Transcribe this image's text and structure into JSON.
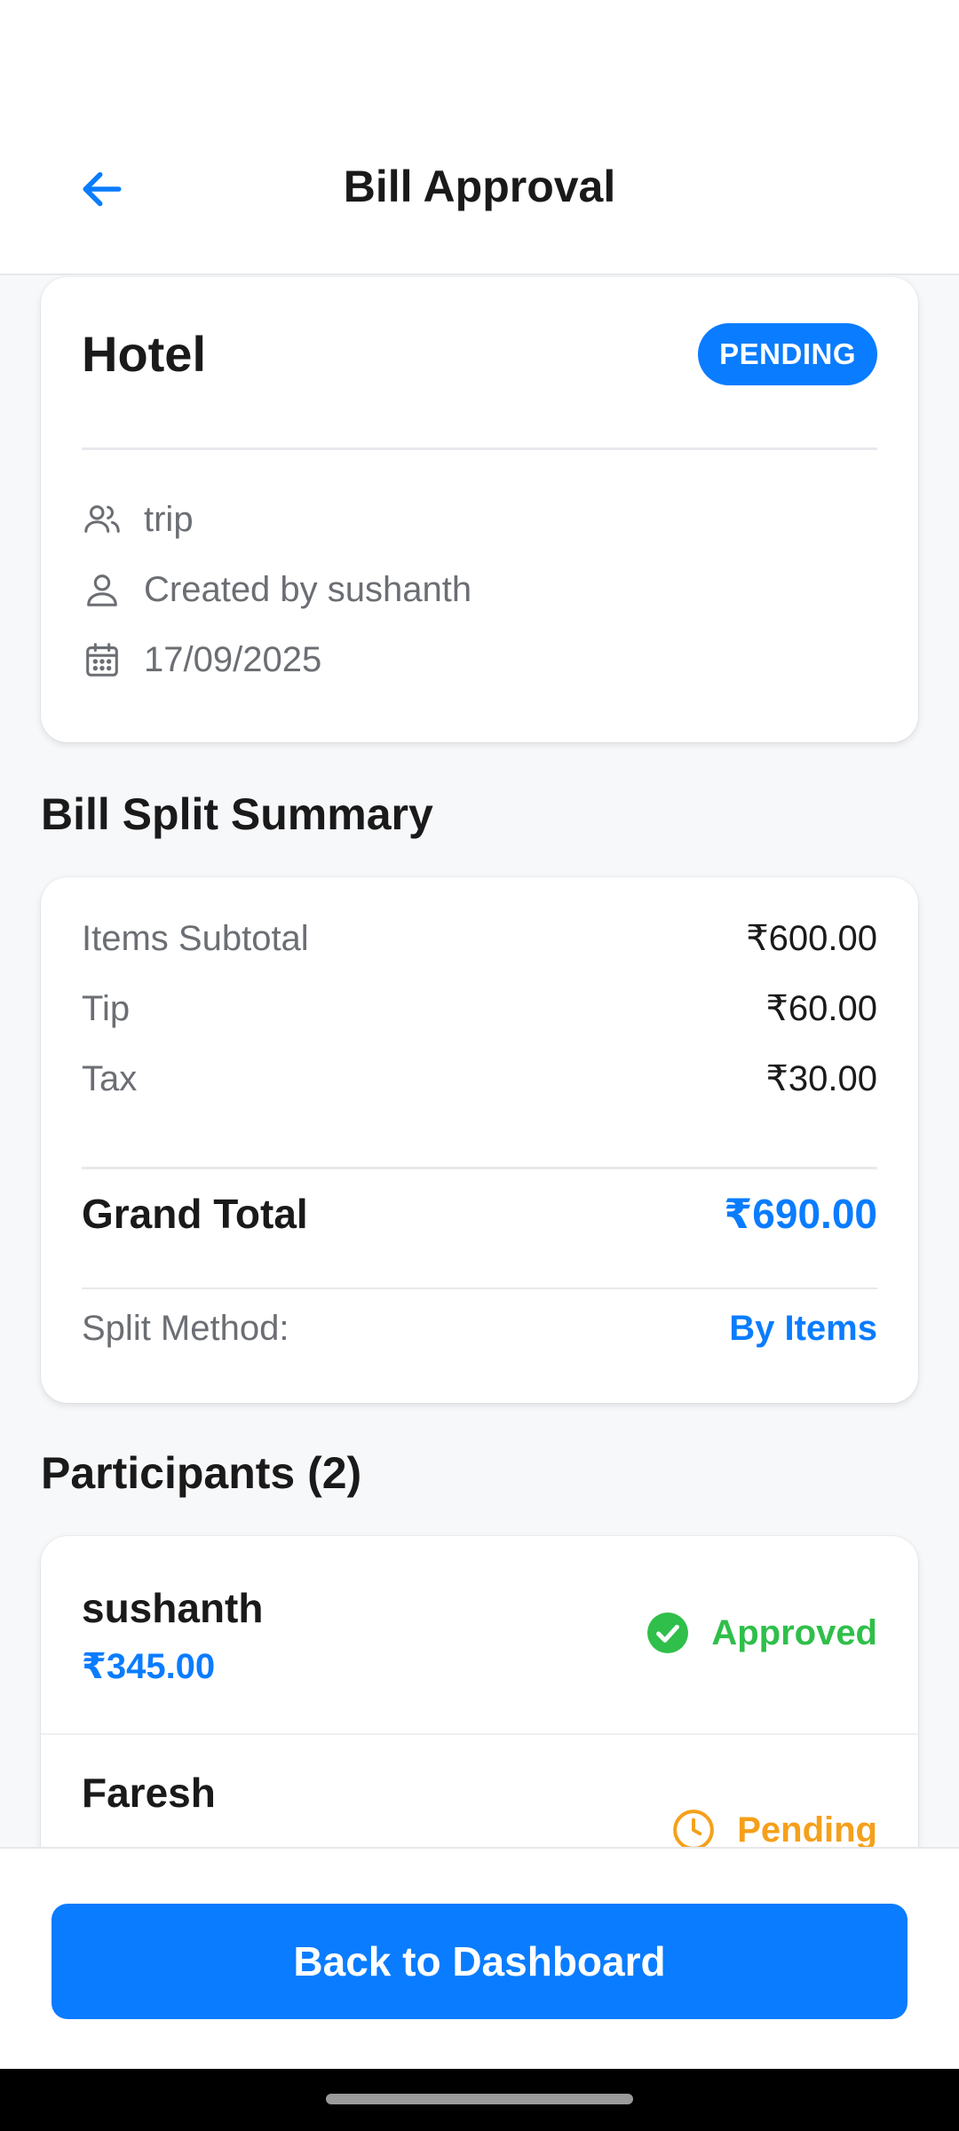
{
  "header": {
    "title": "Bill Approval"
  },
  "bill": {
    "name": "Hotel",
    "status": "PENDING",
    "group": "trip",
    "created_by": "Created by sushanth",
    "date": "17/09/2025"
  },
  "summary": {
    "title": "Bill Split Summary",
    "rows": [
      {
        "label": "Items Subtotal",
        "value": "₹600.00"
      },
      {
        "label": "Tip",
        "value": "₹60.00"
      },
      {
        "label": "Tax",
        "value": "₹30.00"
      }
    ],
    "grand_total_label": "Grand Total",
    "grand_total_value": "₹690.00",
    "split_method_label": "Split Method:",
    "split_method_value": "By Items"
  },
  "participants": {
    "title": "Participants (2)",
    "items": [
      {
        "name": "sushanth",
        "amount": "₹345.00",
        "status": "Approved"
      },
      {
        "name": "Faresh",
        "status": "Pending"
      }
    ]
  },
  "footer": {
    "button_label": "Back to Dashboard"
  },
  "colors": {
    "accent": "#0a7cff",
    "approved": "#2fbf4a",
    "pending": "#f5a01a"
  },
  "icons": {
    "back": "arrow-left-icon",
    "group": "users-icon",
    "creator": "user-icon",
    "date": "calendar-icon",
    "approved": "check-circle-icon",
    "pending": "clock-icon"
  }
}
